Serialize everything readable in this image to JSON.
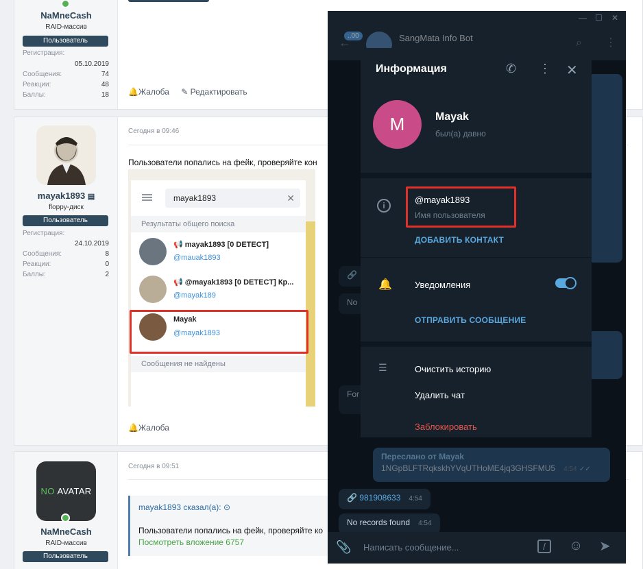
{
  "post1": {
    "username": "NaMneCash",
    "user_title": "RAID-массив",
    "badge": "Пользователь",
    "reg_label": "Регистрация:",
    "reg_date": "05.10.2019",
    "msgs_label": "Сообщения:",
    "msgs": "74",
    "react_label": "Реакции:",
    "react": "48",
    "points_label": "Баллы:",
    "points": "18",
    "complain": "Жалоба",
    "edit": "Редактировать"
  },
  "post2": {
    "username": "mayak1893",
    "user_title": "floppy-диск",
    "badge": "Пользователь",
    "reg_label": "Регистрация:",
    "reg_date": "24.10.2019",
    "msgs_label": "Сообщения:",
    "msgs": "8",
    "react_label": "Реакции:",
    "react": "0",
    "points_label": "Баллы:",
    "points": "2",
    "time": "Сегодня в 09:46",
    "text": "Пользователи попались на фейк, проверяйте кон",
    "complain": "Жалоба",
    "screenshot": {
      "search_value": "mayak1893",
      "section_label": "Результаты общего поиска",
      "results": [
        {
          "name": "mayak1893 [0 DETECT]",
          "handle": "@mauak1893"
        },
        {
          "name": "@mayak1893 [0 DETECT] Кр...",
          "handle": "@mayak189"
        },
        {
          "name": "Mayak",
          "handle": "@mayak1893"
        }
      ],
      "no_messages": "Сообщения не найдены"
    }
  },
  "post3": {
    "no_avatar_no": "NO",
    "no_avatar_avatar": "AVATAR",
    "username": "NaMneCash",
    "user_title": "RAID-массив",
    "badge": "Пользователь",
    "time": "Сегодня в 09:51",
    "quote_author": "mayak1893 сказал(а):",
    "quote_text": "Пользователи попались на фейк, проверяйте ко",
    "quote_link": "Посмотреть вложение 6757"
  },
  "telegram": {
    "chat_title": "SangMata Info Bot",
    "unread_badge": "..00",
    "modal": {
      "title": "Информация",
      "avatar_letter": "M",
      "name": "Mayak",
      "status": "был(а) давно",
      "username": "@mayak1893",
      "username_label": "Имя пользователя",
      "add_contact": "ДОБАВИТЬ КОНТАКТ",
      "notifications": "Уведомления",
      "notifications_on": true,
      "send_message": "ОТПРАВИТЬ СООБЩЕНИЕ",
      "clear_history": "Очистить историю",
      "delete_chat": "Удалить чат",
      "block": "Заблокировать"
    },
    "messages": {
      "forwarded_label": "Переслано от Mayak",
      "forwarded_text": "1NGpBLFTRqkskhYVqUTHoME4jq3GHSFMU5",
      "forwarded_time": "4:54",
      "number": "981908633",
      "number_time": "4:54",
      "no_records": "No records found",
      "no_records_time": "4:54",
      "partial_no": "No",
      "partial_for": "For"
    },
    "input_placeholder": "Написать сообщение..."
  }
}
